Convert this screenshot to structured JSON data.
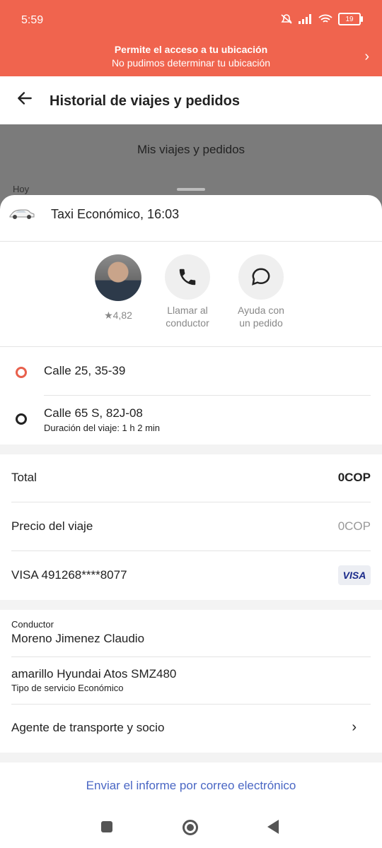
{
  "status": {
    "time": "5:59",
    "battery": "19"
  },
  "banner": {
    "title": "Permite el acceso a tu ubicación",
    "subtitle": "No pudimos determinar tu ubicación"
  },
  "header": {
    "title": "Historial de viajes y pedidos"
  },
  "background": {
    "section_title": "Mis viajes y pedidos",
    "day_label": "Hoy"
  },
  "trip": {
    "title": "Taxi Económico, 16:03"
  },
  "actions": {
    "rating": "★4,82",
    "call_label_1": "Llamar al",
    "call_label_2": "conductor",
    "help_label_1": "Ayuda con",
    "help_label_2": "un pedido"
  },
  "route": {
    "origin": "Calle 25, 35-39",
    "destination": "Calle 65 S, 82J-08",
    "duration": "Duración del viaje: 1 h 2 min"
  },
  "payment": {
    "total_label": "Total",
    "total_value": "0COP",
    "price_label": "Precio del viaje",
    "price_value": "0COP",
    "card": "VISA 491268****8077",
    "card_brand": "VISA"
  },
  "driver": {
    "label": "Conductor",
    "name": "Moreno Jimenez Claudio",
    "vehicle": "amarillo Hyundai Atos SMZ480",
    "service": "Tipo de servicio Económico",
    "agent": "Agente de transporte y socio"
  },
  "email_link": "Enviar el informe por correo electrónico",
  "colors": {
    "accent": "#f0644e",
    "link": "#4a67c4",
    "origin_dot": "#e8604c"
  }
}
